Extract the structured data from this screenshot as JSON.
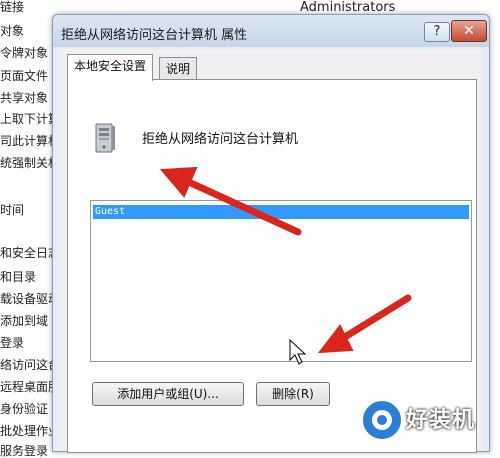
{
  "background_list": {
    "column_header": "Administrators",
    "items": [
      "链接",
      "对象",
      "令牌对象",
      "页面文件",
      "共享对象",
      "上取下计算",
      "司此计算机",
      "统强制关机",
      "",
      "",
      "时间",
      "",
      "",
      "和安全日志",
      "和目录",
      "载设备驱动",
      "添加到域",
      "登录",
      "络访问这台",
      "远程桌面服",
      "身份验证",
      "批处理作业",
      "服务登录"
    ]
  },
  "dialog": {
    "title": "拒绝从网络访问这台计算机 属性",
    "help_label": "?",
    "close_label": "✕",
    "tabs": [
      {
        "label": "本地安全设置",
        "active": true
      },
      {
        "label": "说明",
        "active": false
      }
    ],
    "policy_name": "拒绝从网络访问这台计算机",
    "list_items": [
      "Guest"
    ],
    "add_button": "添加用户或组(U)...",
    "remove_button": "删除(R)"
  },
  "watermark": {
    "text": "好装机"
  },
  "colors": {
    "selection": "#3399ff",
    "arrow": "#d9251c",
    "title_gradient_top": "#dde8f4"
  }
}
